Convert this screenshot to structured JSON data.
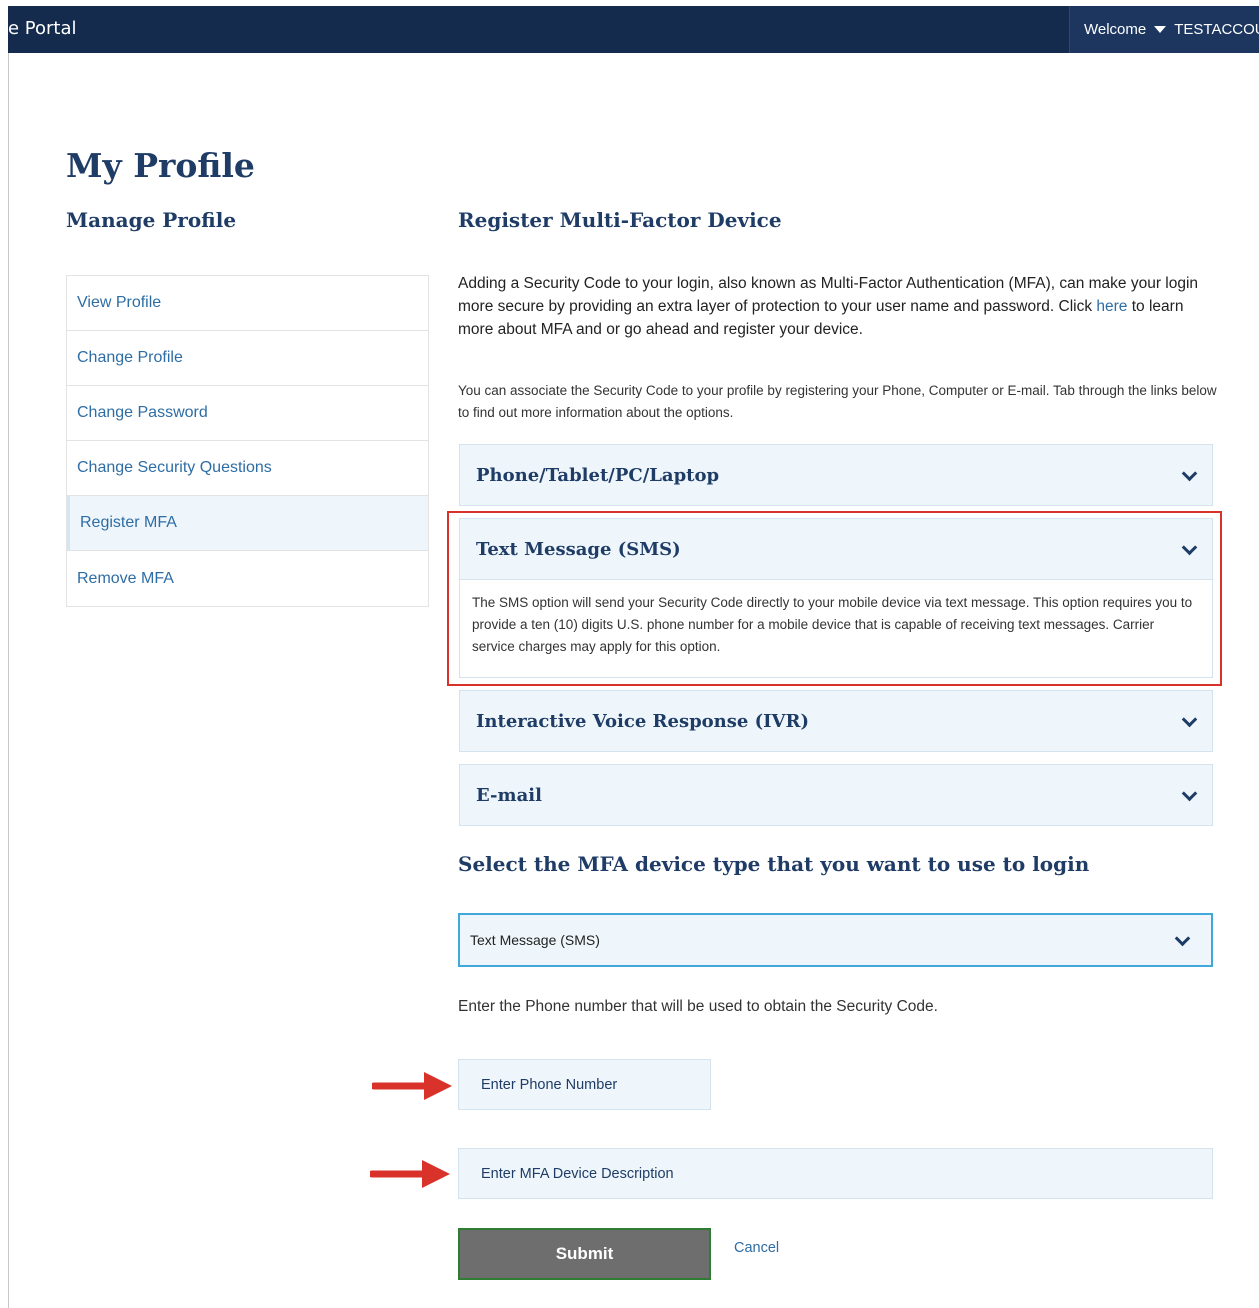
{
  "header": {
    "portal_title": "e Portal",
    "welcome_label": "Welcome",
    "username": "TESTACCOU"
  },
  "page": {
    "title": "My Profile",
    "manage_title": "Manage Profile"
  },
  "sidebar": {
    "items": [
      {
        "label": "View Profile",
        "active": false
      },
      {
        "label": "Change Profile",
        "active": false
      },
      {
        "label": "Change Password",
        "active": false
      },
      {
        "label": "Change Security Questions",
        "active": false
      },
      {
        "label": "Register MFA",
        "active": true
      },
      {
        "label": "Remove MFA",
        "active": false
      }
    ]
  },
  "main": {
    "section_title": "Register Multi-Factor Device",
    "intro_text": "Adding a Security Code to your login, also known as Multi-Factor Authentication (MFA), can make your login more secure by providing an extra layer of protection to your user name and password. Click",
    "intro_link": "here",
    "intro_text_after": "to learn more about MFA and or go ahead and register your device.",
    "assoc_text": "You can associate the Security Code to your profile by registering your Phone, Computer or E-mail. Tab through the links below to find out more information about the options.",
    "accordions": [
      {
        "label": "Phone/Tablet/PC/Laptop"
      },
      {
        "label": "Text Message (SMS)",
        "body": "The SMS option will send your Security Code directly to your mobile device via text message. This option requires you to provide a ten (10) digits U.S. phone number for a mobile device that is capable of receiving text messages. Carrier service charges may apply for this option."
      },
      {
        "label": "Interactive Voice Response (IVR)"
      },
      {
        "label": "E-mail"
      }
    ],
    "select_title": "Select the MFA device type that you want to use to login",
    "select_value": "Text Message (SMS)",
    "phone_instruction": "Enter the Phone number that will be used to obtain the Security Code.",
    "phone_placeholder": "Enter Phone Number",
    "description_placeholder": "Enter MFA Device Description",
    "submit_label": "Submit",
    "cancel_label": "Cancel"
  },
  "colors": {
    "header_bg": "#142b4d",
    "accent_blue": "#1f3c66",
    "link_blue": "#2e6da4",
    "highlight_red": "#d9322b",
    "submit_bg": "#6e6e6e"
  },
  "icons": [
    "caret-down-icon",
    "chevron-down-icon",
    "red-arrow-icon"
  ]
}
